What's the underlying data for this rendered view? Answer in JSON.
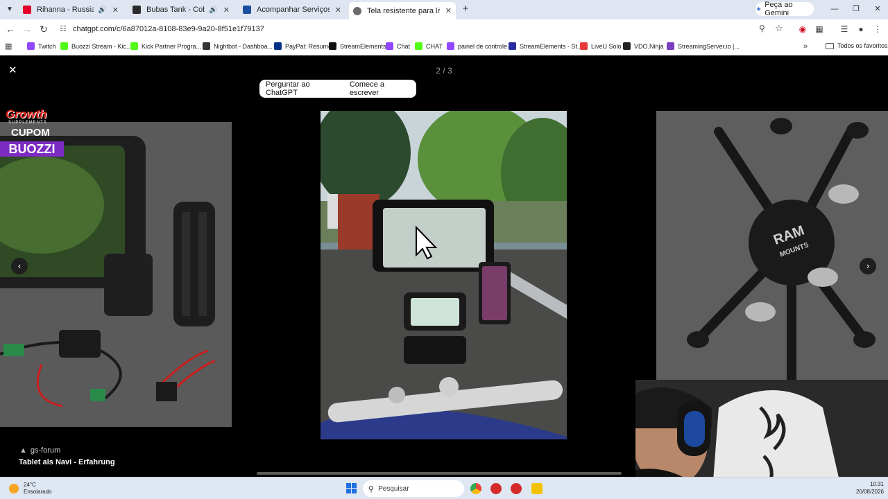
{
  "tabs": [
    {
      "title": "Rihanna - Russian Roulette",
      "audio": true,
      "active": false,
      "color": "#e4002b"
    },
    {
      "title": "Bubas Tank - Cobras — Bail",
      "audio": true,
      "active": false,
      "color": "#2b2b2b"
    },
    {
      "title": "Acompanhar Serviços de Veícul",
      "audio": false,
      "active": false,
      "color": "#1a4fa0"
    },
    {
      "title": "Tela resistente para lives",
      "audio": false,
      "active": true,
      "color": "#6b6b6b"
    }
  ],
  "gemini": {
    "label": "Peça ao Gemini"
  },
  "address": {
    "url": "chatgpt.com/c/6a87012a-8108-83e9-9a20-8f51e1f79137"
  },
  "bookmarks": [
    {
      "label": "Twitch",
      "color": "#9146ff"
    },
    {
      "label": "Buozzi Stream - Kic...",
      "color": "#53fc18"
    },
    {
      "label": "Kick Partner Progra...",
      "color": "#53fc18"
    },
    {
      "label": "Nightbot - Dashboa...",
      "color": "#333333"
    },
    {
      "label": "PayPal: Resumo",
      "color": "#003087"
    },
    {
      "label": "StreamElements",
      "color": "#111111"
    },
    {
      "label": "Chat",
      "color": "#9146ff"
    },
    {
      "label": "CHAT",
      "color": "#53fc18"
    },
    {
      "label": "painel de controle",
      "color": "#9146ff"
    },
    {
      "label": "StreamElements - St...",
      "color": "#2a2aa0"
    },
    {
      "label": "LiveU Solo",
      "color": "#e63a3a"
    },
    {
      "label": "VDO.Ninja",
      "color": "#222222"
    },
    {
      "label": "StreamingServer.io |...",
      "color": "#7a3fc0"
    }
  ],
  "all_bookmarks": "Todos os favoritos",
  "viewer": {
    "counter": "2 / 3",
    "ask_button": "Perguntar ao ChatGPT",
    "write_button": "Comece a escrever",
    "source": "gs-forum",
    "title": "Tablet als Navi - Erfahrung"
  },
  "promo": {
    "brand": "Growth",
    "subtitle": "SUPPLEMENTS",
    "line1": "CUPOM",
    "code": "BUOZZI"
  },
  "taskbar": {
    "temp": "24°C",
    "condition": "Ensolarado",
    "search_placeholder": "Pesquisar",
    "time": "10:31",
    "date": "20/08/2026"
  }
}
